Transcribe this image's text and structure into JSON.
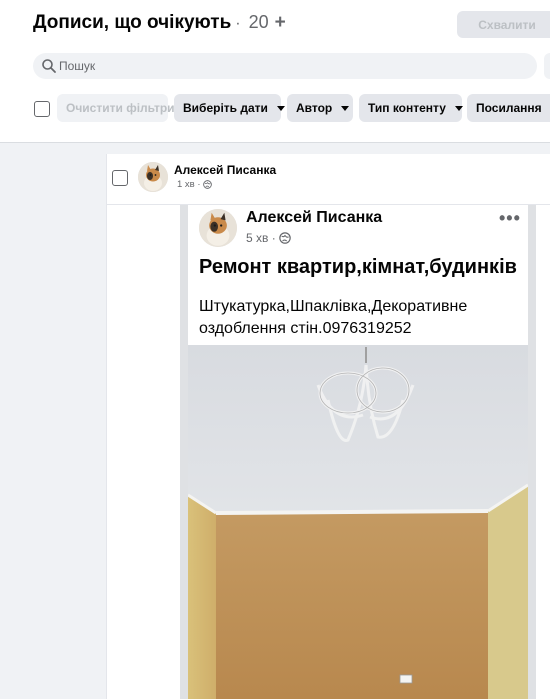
{
  "header": {
    "title": "Дописи, що очікують",
    "count": "20",
    "approve_label": "Схвалити"
  },
  "search": {
    "placeholder": "Пошук"
  },
  "filters": {
    "clear_label": "Очистити фільтри",
    "date_label": "Виберіть дати",
    "author_label": "Автор",
    "content_type_label": "Тип контенту",
    "links_label": "Посилання"
  },
  "post": {
    "author": "Алексей Писанка",
    "time": "1 хв",
    "screenshot": {
      "author": "Алексей Писанка",
      "time": "5 хв",
      "headline": "Ремонт квартир,кімнат,будинків",
      "body": "Штукатурка,Шпаклівка,Декоративне оздоблення стін.0976319252"
    }
  },
  "icons": [
    "search-icon",
    "globe-icon",
    "more-icon",
    "chevron-down-icon"
  ],
  "colors": {
    "accent_grey": "#e4e6eb",
    "background": "#f0f2f5",
    "text_secondary": "#65676b"
  }
}
